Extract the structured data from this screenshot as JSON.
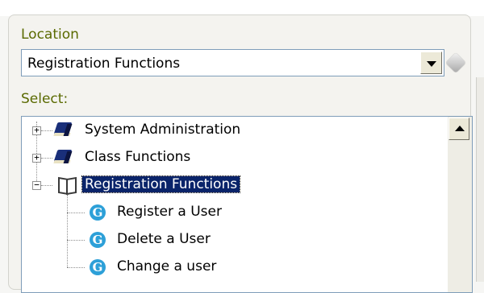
{
  "location": {
    "label": "Location",
    "selected_value": "Registration Functions"
  },
  "select": {
    "label": "Select:"
  },
  "tree": {
    "items": [
      {
        "label": "System Administration",
        "icon": "book-icon",
        "expanded": false
      },
      {
        "label": "Class Functions",
        "icon": "book-icon",
        "expanded": false
      },
      {
        "label": "Registration Functions",
        "icon": "open-book-icon",
        "expanded": true,
        "selected": true
      },
      {
        "label": "Register a User",
        "icon": "function-g-icon"
      },
      {
        "label": "Delete a User",
        "icon": "function-g-icon"
      },
      {
        "label": "Change a user",
        "icon": "function-g-icon"
      }
    ],
    "expander_expanded": "−",
    "expander_collapsed": "+",
    "function_glyph": "G"
  },
  "colors": {
    "label_text": "#5a6a00",
    "selection": "#0a246a",
    "function_icon": "#2da0d8",
    "book_icon": "#1a2f7a"
  }
}
